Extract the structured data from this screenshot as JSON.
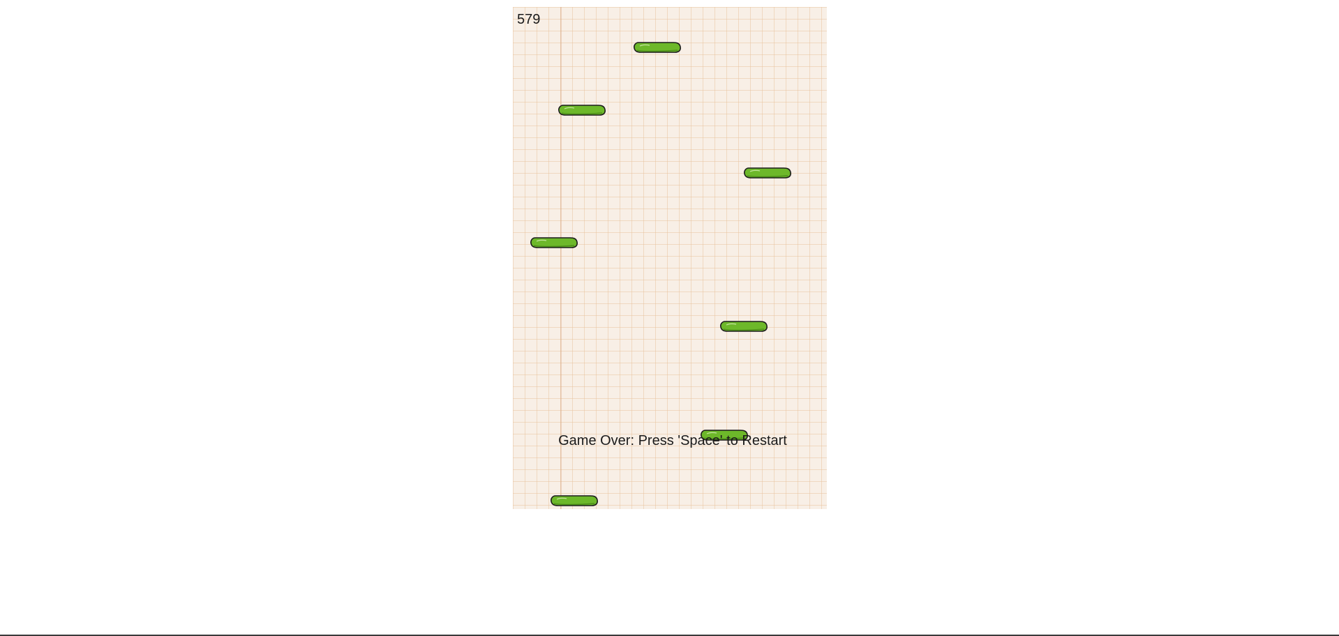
{
  "game": {
    "score": "579",
    "game_over_message": "Game Over: Press 'Space' to Restart"
  },
  "colors": {
    "paper": "#f8efe6",
    "grid": "#e8c4a0",
    "platform_fill": "#6db82a",
    "platform_outline": "#1c1c1c"
  },
  "platforms": [
    {
      "icon": "green-platform"
    },
    {
      "icon": "green-platform"
    },
    {
      "icon": "green-platform"
    },
    {
      "icon": "green-platform"
    },
    {
      "icon": "green-platform"
    },
    {
      "icon": "green-platform"
    },
    {
      "icon": "green-platform"
    }
  ]
}
